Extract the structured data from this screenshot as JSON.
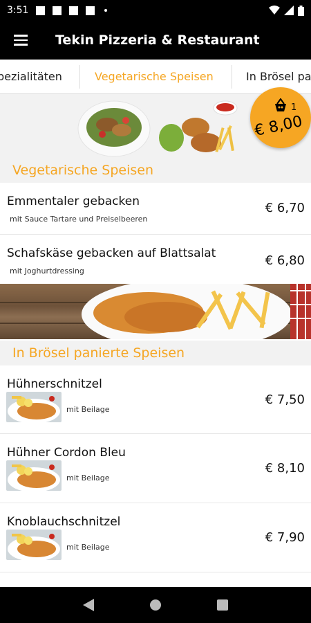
{
  "status": {
    "time": "3:51"
  },
  "app": {
    "title": "Tekin Pizzeria & Restaurant"
  },
  "tabs": [
    {
      "label": "pezialitäten"
    },
    {
      "label": "Vegetarische Speisen"
    },
    {
      "label": "In Brösel pa"
    }
  ],
  "cart": {
    "count": "1",
    "total": "€ 8,00"
  },
  "sections": [
    {
      "title": "Vegetarische Speisen",
      "items": [
        {
          "name": "Emmentaler gebacken",
          "desc": "mit Sauce Tartare und Preiselbeeren",
          "price": "€ 6,70"
        },
        {
          "name": "Schafskäse gebacken auf Blattsalat",
          "desc": "mit Joghurtdressing",
          "price": "€ 6,80"
        }
      ]
    },
    {
      "title": "In Brösel panierte Speisen",
      "items": [
        {
          "name": "Hühnerschnitzel",
          "desc": "mit Beilage",
          "price": "€ 7,50"
        },
        {
          "name": "Hühner Cordon Bleu",
          "desc": "mit Beilage",
          "price": "€ 8,10"
        },
        {
          "name": "Knoblauchschnitzel",
          "desc": "mit Beilage",
          "price": "€ 7,90"
        }
      ]
    }
  ],
  "colors": {
    "accent": "#f5a623",
    "bar": "#000000"
  },
  "icons": [
    "menu-icon",
    "basket-icon",
    "wifi-icon",
    "battery-icon",
    "back-icon",
    "home-icon",
    "recents-icon"
  ]
}
